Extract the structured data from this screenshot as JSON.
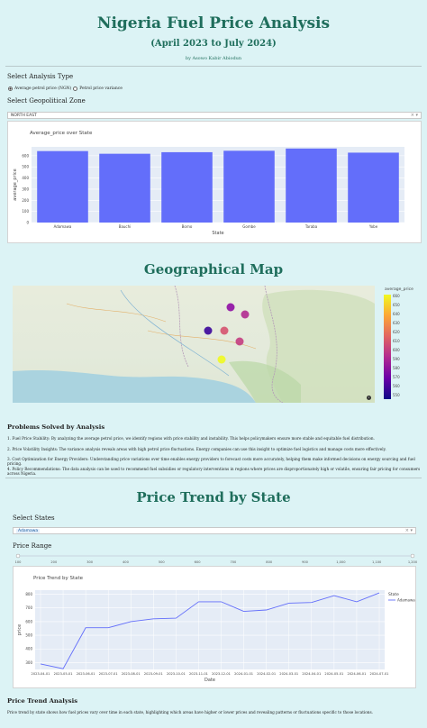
{
  "header": {
    "title": "Nigeria Fuel Price Analysis",
    "subtitle": "(April 2023 to July 2024)",
    "byline": "by Asowo Kabir Abiodun"
  },
  "analysis": {
    "type_label": "Select Analysis Type",
    "options": [
      "Average petrol price (NGN)",
      "Petrol price variance"
    ],
    "zone_label": "Select Geopolitical Zone",
    "zone_value": "NORTH EAST"
  },
  "bar_chart": {
    "title": "Average_price over State",
    "xlabel": "State",
    "ylabel": "average_price",
    "y_ticks": [
      "0",
      "100",
      "200",
      "300",
      "400",
      "500",
      "600"
    ]
  },
  "map_section": {
    "title": "Geographical Map",
    "colorbar_title": "average_price",
    "colorbar_ticks": [
      "660",
      "650",
      "640",
      "630",
      "620",
      "610",
      "600",
      "590",
      "580",
      "570",
      "560",
      "550"
    ],
    "colors": {
      "low": "#0d0887",
      "high": "#f0f921"
    }
  },
  "problems": {
    "title": "Problems Solved by Analysis",
    "items": [
      "1. Fuel Price Stability: By analyzing the average petrol price, we identify regions with price stability and instability. This helps policymakers ensure more stable and equitable fuel distribution.",
      "2. Price Volatility Insights: The variance analysis reveals areas with high petrol price fluctuations. Energy companies can use this insight to optimize fuel logistics and manage costs more effectively.",
      "3. Cost Optimization for Energy Providers: Understanding price variations over time enables energy providers to forecast costs more accurately, helping them make informed decisions on energy sourcing and fuel pricing.",
      "4. Policy Recommendations: The data analysis can be used to recommend fuel subsidies or regulatory interventions in regions where prices are disproportionately high or volatile, ensuring fair pricing for consumers across Nigeria."
    ]
  },
  "trend_section": {
    "title": "Price Trend by State",
    "states_label": "Select States",
    "selected_state": "Adamawa",
    "range_label": "Price Range",
    "range_ticks": [
      "100",
      "200",
      "300",
      "400",
      "500",
      "600",
      "700",
      "800",
      "900",
      "1,000",
      "1,100",
      "1,200"
    ],
    "chart_title": "Price Trend by State",
    "xlabel": "Date",
    "ylabel": "price",
    "legend_title": "State",
    "legend_item": "Adamawa",
    "y_ticks": [
      "300",
      "400",
      "500",
      "600",
      "700",
      "800"
    ]
  },
  "trend_summary": {
    "title": "Price Trend Analysis",
    "text": "Price trend by state shows how fuel prices vary over time in each state, highlighting which areas have higher or lower prices and revealing patterns or fluctuations specific to those locations."
  },
  "chart_data": [
    {
      "type": "bar",
      "title": "Average_price over State",
      "xlabel": "State",
      "ylabel": "average_price",
      "categories": [
        "Adamawa",
        "Bauchi",
        "Borno",
        "Gombe",
        "Taraba",
        "Yobe"
      ],
      "values": [
        642,
        618,
        632,
        645,
        665,
        628
      ],
      "ylim": [
        0,
        680
      ],
      "color": "#636efa"
    },
    {
      "type": "line",
      "title": "Price Trend by State",
      "xlabel": "Date",
      "ylabel": "price",
      "x": [
        "2023-04-01",
        "2023-05-01",
        "2023-06-01",
        "2023-07-01",
        "2023-08-01",
        "2023-09-01",
        "2023-10-01",
        "2023-11-01",
        "2023-12-01",
        "2024-01-01",
        "2024-02-01",
        "2024-03-01",
        "2024-04-01",
        "2024-05-01",
        "2024-06-01",
        "2024-07-01"
      ],
      "series": [
        {
          "name": "Adamawa",
          "values": [
            290,
            255,
            555,
            555,
            600,
            620,
            625,
            745,
            745,
            675,
            685,
            735,
            740,
            790,
            745,
            810
          ]
        }
      ],
      "ylim": [
        250,
        830
      ],
      "color": "#636efa"
    }
  ],
  "map_points": [
    {
      "state": "Adamawa",
      "value": 642,
      "color": "#c33d80"
    },
    {
      "state": "Bauchi",
      "value": 618,
      "color": "#8f0da4"
    },
    {
      "state": "Borno",
      "value": 632,
      "color": "#b12a90"
    },
    {
      "state": "Gombe",
      "value": 645,
      "color": "#d5536f"
    },
    {
      "state": "Taraba",
      "value": 665,
      "color": "#f0f921"
    },
    {
      "state": "Yobe",
      "value": 628,
      "color": "#3a049a"
    }
  ]
}
